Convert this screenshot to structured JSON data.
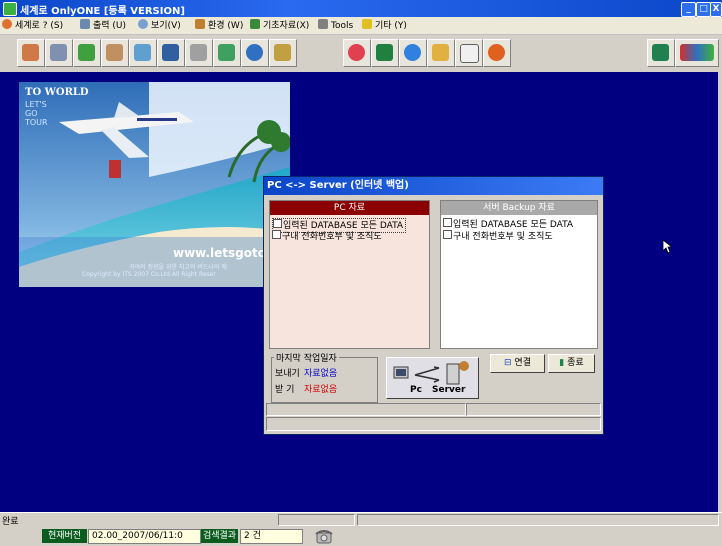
{
  "window": {
    "title": "세계로 OnlyONE [등록 VERSION]",
    "controls": [
      "_",
      "□",
      "X"
    ]
  },
  "menu": [
    {
      "label": "세계로 ? (S)",
      "icon": "person-icon"
    },
    {
      "label": "출력 (U)",
      "icon": "printer-icon"
    },
    {
      "label": "보기(V)",
      "icon": "search-icon"
    },
    {
      "label": "환경 (W)",
      "icon": "settings-icon"
    },
    {
      "label": "기초자료(X)",
      "icon": "data-icon"
    },
    {
      "label": "Tools",
      "icon": "tools-icon"
    },
    {
      "label": "기타 (Y)",
      "icon": "star-icon"
    }
  ],
  "toolbar": {
    "group1": [
      "user-icon",
      "pen-icon",
      "notebook-icon",
      "person-card-icon",
      "checklist-icon",
      "window-icon",
      "calculator-icon",
      "camera-icon",
      "globe-icon",
      "pyramid-icon"
    ],
    "group2": [
      "lifebuoy-icon",
      "excel-icon",
      "internet-explorer-icon",
      "magnifier-icon",
      "notepad-icon",
      "email-icon"
    ],
    "group3": [
      "exit-door-icon",
      "its-logo-icon"
    ]
  },
  "banner": {
    "headline": "TO WORLD",
    "sub1": "LET'S",
    "sub2": "GO",
    "sub3": "TOUR",
    "website": "www.letsgotour",
    "small1": "귀여의 정광을 위한 허고의 버드나의 애",
    "small2": "Copyright by ITS 2007 Co.Ltd   All Right Reser"
  },
  "dialog": {
    "title": "PC <-> Server (인터넷 백업)",
    "pc_header": "PC 자료",
    "server_header": "서버 Backup 자료",
    "pc_items": [
      "입력된 DATABASE 모든 DATA",
      "구내 전화번호부 및 조직도"
    ],
    "server_items": [
      "입력된 DATABASE 모든 DATA",
      "구내 전화번호부 및 조직도"
    ],
    "last_work_label": "마지막 작업일자",
    "send_label": "보내기",
    "send_value": "자료없음",
    "recv_label": "받 기",
    "recv_value": "자료없음",
    "connect_button": "연결",
    "close_button": "종료",
    "transfer_pc": "Pc",
    "transfer_server": "Server"
  },
  "status": {
    "text": "완료",
    "version_label": "현재버전",
    "version_value": "02.00_2007/06/11:0",
    "result_label": "검색결과",
    "result_value": "2 건"
  },
  "colors": {
    "desktop": "#000080",
    "pc_header": "#8b0000",
    "server_header": "#a9a9a9",
    "pc_panel": "#f7e4dc",
    "status_value": "#0000cc",
    "recv_value": "#cc0000"
  }
}
